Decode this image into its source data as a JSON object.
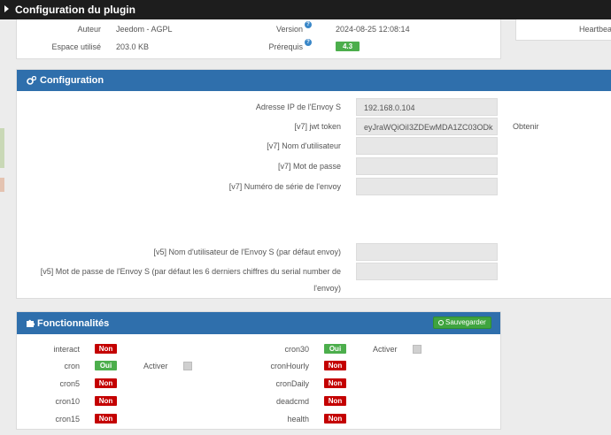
{
  "window": {
    "title": "Configuration du plugin"
  },
  "info": {
    "author_label": "Auteur",
    "author_value": "Jeedom - AGPL",
    "space_label": "Espace utilisé",
    "space_value": "203.0 KB",
    "version_label": "Version",
    "version_value": "2024-08-25 12:08:14",
    "prereq_label": "Prérequis",
    "prereq_value": "4.3",
    "help_glyph": "?",
    "right_label": "Heartbeat"
  },
  "config": {
    "title": "Configuration",
    "ip_label": "Adresse IP de l'Envoy S",
    "ip_value": "192.168.0.104",
    "jwt_label": "[v7] jwt token",
    "jwt_value": "eyJraWQiOiI3ZDEwMDA1ZC03ODk",
    "jwt_link": "Obtenir",
    "user7_label": "[v7] Nom d'utilisateur",
    "user7_value": "",
    "pass7_label": "[v7] Mot de passe",
    "pass7_value": "",
    "serial7_label": "[v7] Numéro de série de l'envoy",
    "serial7_value": "",
    "user5_label": "[v5] Nom d'utilisateur de l'Envoy S (par défaut envoy)",
    "user5_value": "",
    "pass5_label_line1": "[v5] Mot de passe de l'Envoy S (par défaut les 6 derniers chiffres du serial number de",
    "pass5_label_line2": "l'envoy)",
    "pass5_value": ""
  },
  "features": {
    "title": "Fonctionnalités",
    "save_label": "Sauvegarder",
    "enable_label": "Activer",
    "left": [
      {
        "name": "interact",
        "state": "Non"
      },
      {
        "name": "cron",
        "state": "Oui"
      },
      {
        "name": "cron5",
        "state": "Non"
      },
      {
        "name": "cron10",
        "state": "Non"
      },
      {
        "name": "cron15",
        "state": "Non"
      }
    ],
    "right": [
      {
        "name": "cron30",
        "state": "Oui"
      },
      {
        "name": "cronHourly",
        "state": "Non"
      },
      {
        "name": "cronDaily",
        "state": "Non"
      },
      {
        "name": "deadcmd",
        "state": "Non"
      },
      {
        "name": "health",
        "state": "Non"
      }
    ]
  },
  "colors": {
    "header_blue": "#2f6fac",
    "yes_green": "#4cae4c",
    "no_red": "#c40000",
    "titlebar": "#1d1d1d"
  },
  "icons": {
    "title_caret": "caret-right-icon",
    "config_icon": "gears-icon",
    "features_icon": "puzzle-icon",
    "help_icon": "question-circle-icon",
    "save_icon": "check-circle-icon"
  }
}
